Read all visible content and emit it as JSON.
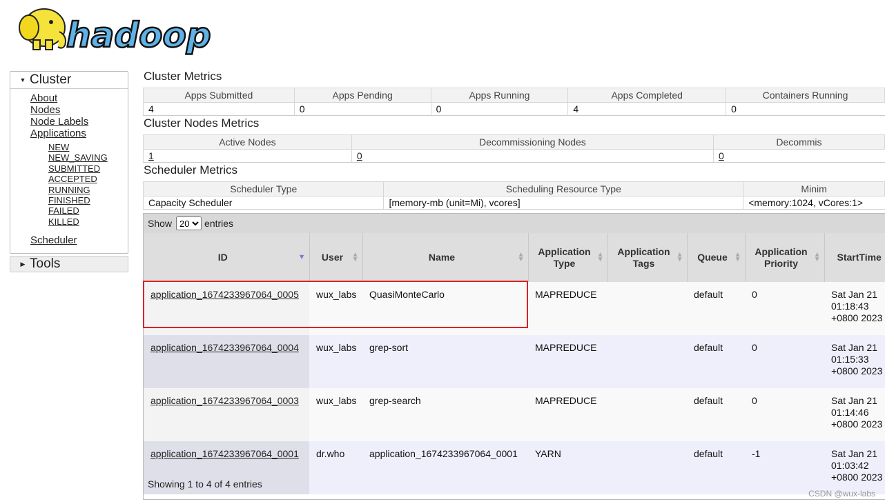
{
  "logo": {
    "text": "hadoop"
  },
  "sidebar": {
    "cluster": {
      "title": "Cluster",
      "links": [
        "About",
        "Nodes",
        "Node Labels",
        "Applications"
      ],
      "app_states": [
        "NEW",
        "NEW_SAVING",
        "SUBMITTED",
        "ACCEPTED",
        "RUNNING",
        "FINISHED",
        "FAILED",
        "KILLED"
      ],
      "scheduler": "Scheduler"
    },
    "tools": {
      "title": "Tools"
    }
  },
  "cluster_metrics": {
    "title": "Cluster Metrics",
    "headers": [
      "Apps Submitted",
      "Apps Pending",
      "Apps Running",
      "Apps Completed",
      "Containers Running"
    ],
    "values": [
      "4",
      "0",
      "0",
      "4",
      "0"
    ]
  },
  "nodes_metrics": {
    "title": "Cluster Nodes Metrics",
    "headers": [
      "Active Nodes",
      "Decommissioning Nodes",
      "Decommis"
    ],
    "values": [
      "1",
      "0",
      "0"
    ]
  },
  "scheduler_metrics": {
    "title": "Scheduler Metrics",
    "headers": [
      "Scheduler Type",
      "Scheduling Resource Type",
      "Minim"
    ],
    "values": [
      "Capacity Scheduler",
      "[memory-mb (unit=Mi), vcores]",
      "<memory:1024, vCores:1>"
    ]
  },
  "apps": {
    "show_label": "Show",
    "entries_label": "entries",
    "page_size": "20",
    "headers": {
      "id": "ID",
      "user": "User",
      "name": "Name",
      "type_1": "Application",
      "type_2": "Type",
      "tags_1": "Application",
      "tags_2": "Tags",
      "queue": "Queue",
      "prio_1": "Application",
      "prio_2": "Priority",
      "start": "StartTime"
    },
    "rows": [
      {
        "id": "application_1674233967064_0005",
        "user": "wux_labs",
        "name": "QuasiMonteCarlo",
        "type": "MAPREDUCE",
        "tags": "",
        "queue": "default",
        "priority": "0",
        "start_1": "Sat Jan 21",
        "start_2": "01:18:43",
        "start_3": "+0800 2023"
      },
      {
        "id": "application_1674233967064_0004",
        "user": "wux_labs",
        "name": "grep-sort",
        "type": "MAPREDUCE",
        "tags": "",
        "queue": "default",
        "priority": "0",
        "start_1": "Sat Jan 21",
        "start_2": "01:15:33",
        "start_3": "+0800 2023"
      },
      {
        "id": "application_1674233967064_0003",
        "user": "wux_labs",
        "name": "grep-search",
        "type": "MAPREDUCE",
        "tags": "",
        "queue": "default",
        "priority": "0",
        "start_1": "Sat Jan 21",
        "start_2": "01:14:46",
        "start_3": "+0800 2023"
      },
      {
        "id": "application_1674233967064_0001",
        "user": "dr.who",
        "name": "application_1674233967064_0001",
        "type": "YARN",
        "tags": "",
        "queue": "default",
        "priority": "-1",
        "start_1": "Sat Jan 21",
        "start_2": "01:03:42",
        "start_3": "+0800 2023"
      }
    ],
    "footer": "Showing 1 to 4 of 4 entries"
  },
  "watermark": "CSDN @wux-labs",
  "colors": {
    "highlight": "#dd1f26",
    "logo_yellow": "#f5e23a",
    "logo_blue": "#5fb2e6"
  }
}
